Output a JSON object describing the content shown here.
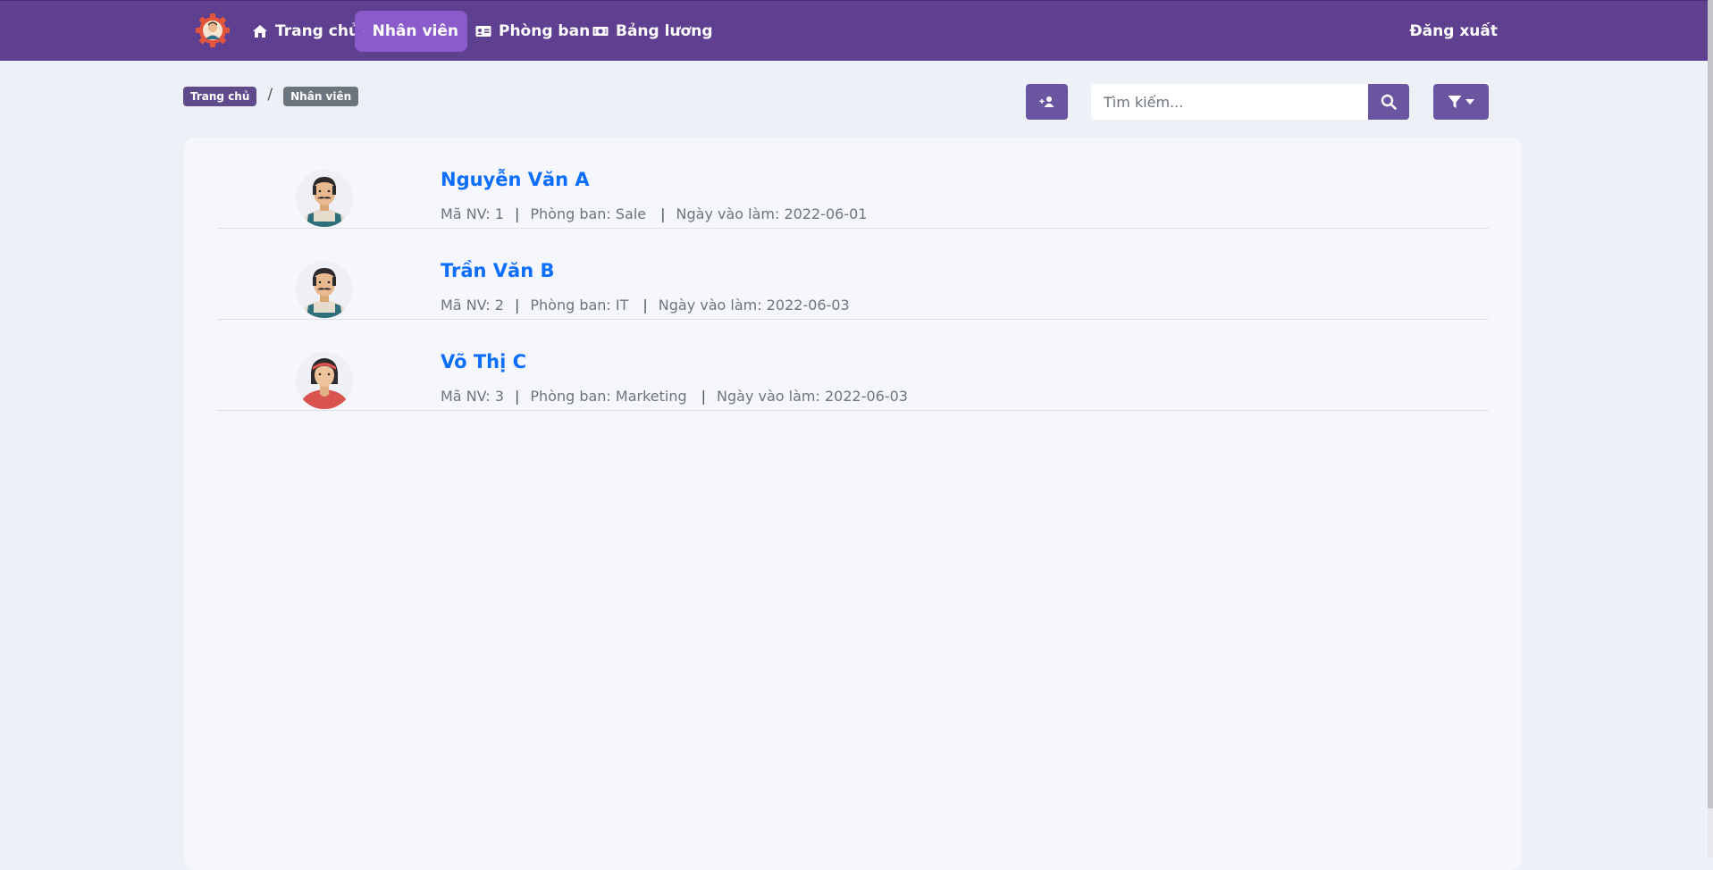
{
  "navbar": {
    "logo": "gear-person-logo",
    "links": [
      {
        "label": "Trang chủ",
        "icon": "home-icon"
      },
      {
        "label": "Nhân viên",
        "icon": "users-icon",
        "active": true
      },
      {
        "label": "Phòng ban",
        "icon": "id-card-icon"
      },
      {
        "label": "Bảng lương",
        "icon": "money-bill-icon"
      }
    ],
    "logout_label": "Đăng xuất"
  },
  "breadcrumb": {
    "home": "Trang chủ",
    "separator": "/",
    "current": "Nhân viên"
  },
  "toolbar": {
    "add_icon": "user-plus-icon",
    "search_placeholder": "Tìm kiếm...",
    "search_value": "",
    "search_icon": "search-icon",
    "filter_icon": "filter-icon"
  },
  "employees": [
    {
      "name": "Nguyễn Văn A",
      "id_label": "Mã NV: 1",
      "dept_label": "Phòng ban: Sale",
      "date_label": "Ngày vào làm: 2022-06-01",
      "avatar": "male-avatar"
    },
    {
      "name": "Trần Văn B",
      "id_label": "Mã NV: 2",
      "dept_label": "Phòng ban: IT",
      "date_label": "Ngày vào làm: 2022-06-03",
      "avatar": "male-avatar"
    },
    {
      "name": "Võ Thị C",
      "id_label": "Mã NV: 3",
      "dept_label": "Phòng ban: Marketing",
      "date_label": "Ngày vào làm: 2022-06-03",
      "avatar": "female-avatar"
    }
  ],
  "colors": {
    "navbar": "#5f3f8f",
    "nav_active": "#8a5ccb",
    "button": "#6a56a0",
    "link": "#0d6efd",
    "page_bg": "#edf0f7",
    "card_bg": "#f6f7fc"
  }
}
